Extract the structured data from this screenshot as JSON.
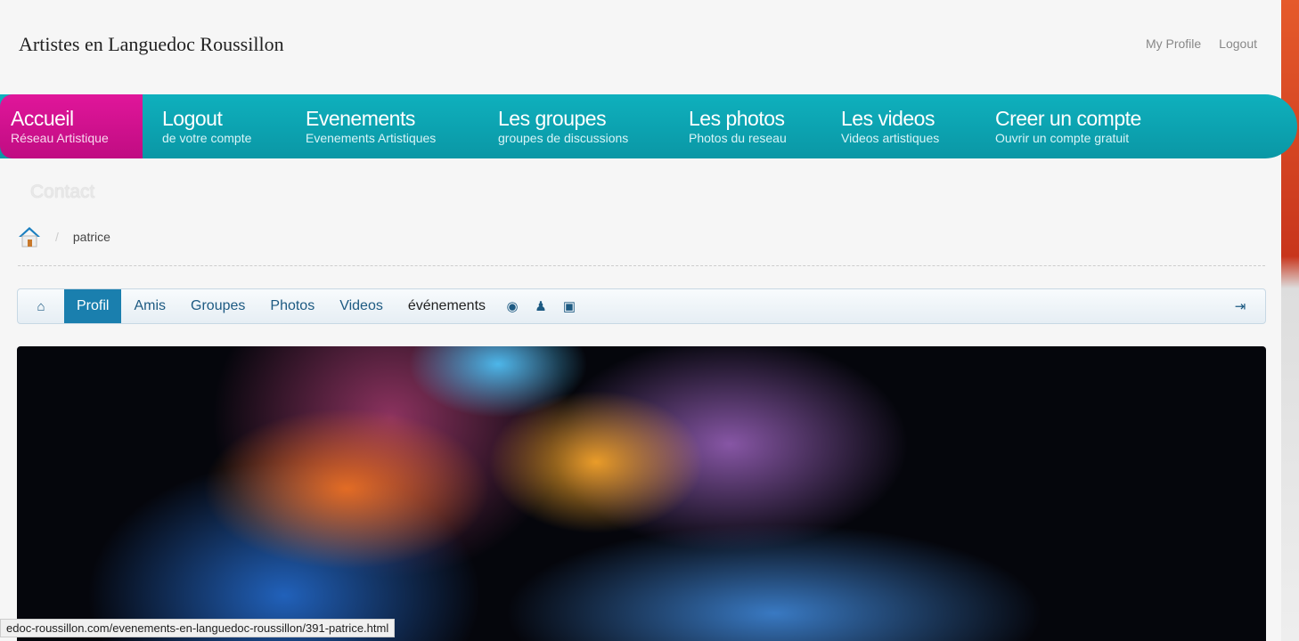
{
  "site_title": "Artistes en Languedoc Roussillon",
  "top_links": [
    "My Profile",
    "Logout"
  ],
  "nav": [
    {
      "title": "Accueil",
      "sub": "Réseau Artistique"
    },
    {
      "title": "Logout",
      "sub": "de votre compte"
    },
    {
      "title": "Evenements",
      "sub": "Evenements Artistiques"
    },
    {
      "title": "Les groupes",
      "sub": "groupes de discussions"
    },
    {
      "title": "Les photos",
      "sub": "Photos du reseau"
    },
    {
      "title": "Les videos",
      "sub": "Videos artistiques"
    },
    {
      "title": "Creer un compte",
      "sub": "Ouvrir un compte gratuit"
    }
  ],
  "contact": "Contact",
  "breadcrumb": {
    "sep": "/",
    "current": "patrice"
  },
  "subnav": {
    "items": [
      "Profil",
      "Amis",
      "Groupes",
      "Photos",
      "Videos",
      "événements"
    ]
  },
  "status_url": "edoc-roussillon.com/evenements-en-languedoc-roussillon/391-patrice.html"
}
